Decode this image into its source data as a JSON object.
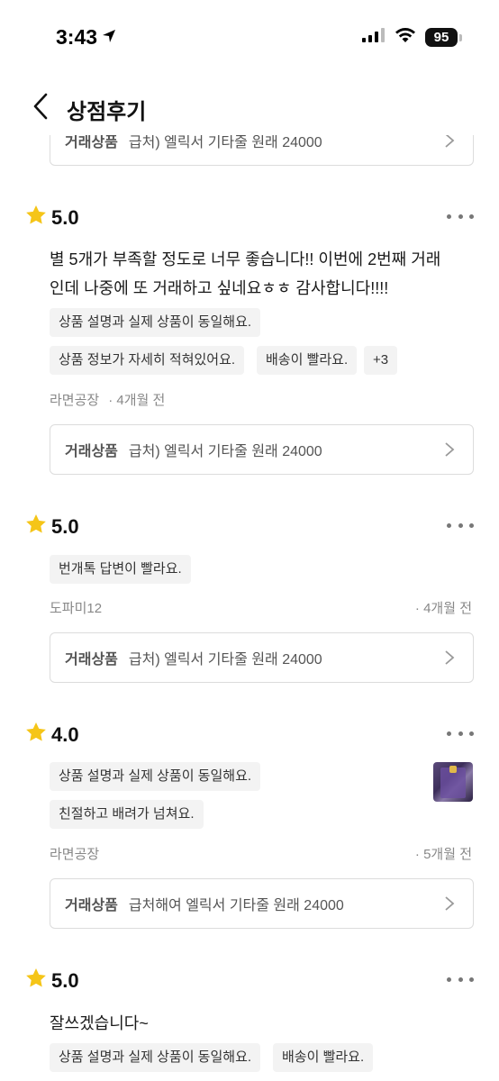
{
  "status": {
    "time": "3:43",
    "battery": "95"
  },
  "header": {
    "title": "상점후기"
  },
  "product_label": "거래상품",
  "top_card": {
    "label": "거래상품",
    "name": "급처) 엘릭서 기타줄 원래 24000"
  },
  "reviews": [
    {
      "rating": "5.0",
      "text": "별 5개가 부족할 정도로 너무 좋습니다!! 이번에 2번째 거래인데 나중에 또 거래하고 싶네요ㅎㅎ 감사합니다!!!!",
      "tags": [
        "상품 설명과 실제 상품이 동일해요.",
        "상품 정보가 자세히 적혀있어요.",
        "배송이 빨라요.",
        "+3"
      ],
      "author": "라면공장",
      "time": "· 4개월 전",
      "product": "급처) 엘릭서 기타줄 원래 24000"
    },
    {
      "rating": "5.0",
      "tags": [
        "번개톡 답변이 빨라요."
      ],
      "author": "도파미12",
      "time": "· 4개월 전",
      "product": "급처) 엘릭서 기타줄 원래 24000"
    },
    {
      "rating": "4.0",
      "tags": [
        "상품 설명과 실제 상품이 동일해요.",
        "친절하고 배려가 넘쳐요."
      ],
      "author": "라면공장",
      "time": "· 5개월 전",
      "product": "급처해여 엘릭서 기타줄 원래 24000"
    },
    {
      "rating": "5.0",
      "text": "잘쓰겠습니다~",
      "tags": [
        "상품 설명과 실제 상품이 동일해요.",
        "배송이 빨라요."
      ]
    }
  ],
  "icons": {
    "star": "star-icon",
    "back": "back-arrow-icon",
    "more": "more-icon",
    "chevron": "chevron-right-icon"
  },
  "colors": {
    "star": "#f5c518",
    "border": "#dcdcdc",
    "tag_bg": "#f3f3f3",
    "meta": "#888888"
  }
}
